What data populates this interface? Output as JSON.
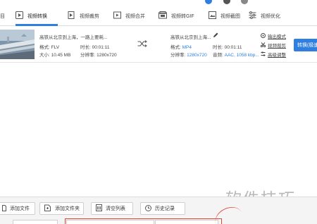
{
  "tabs": [
    {
      "label": "目",
      "icon": "partial-icon"
    },
    {
      "label": "视频转换",
      "icon": "video-convert-icon",
      "active": true
    },
    {
      "label": "视频裁剪",
      "icon": "video-crop-icon"
    },
    {
      "label": "视频合并",
      "icon": "video-merge-icon"
    },
    {
      "label": "视频转GIF",
      "icon": "gif-icon"
    },
    {
      "label": "视频截图",
      "icon": "screenshot-icon"
    },
    {
      "label": "视频优化",
      "icon": "optimize-icon"
    }
  ],
  "file": {
    "source_name": "高铁从北京到上海，一路上要耗...",
    "source_format": "格式: FLV",
    "source_duration": "时长: 00:01:11",
    "source_size": "大小: 10.45 MB",
    "source_resolution": "分辨率: 1280x720",
    "target_name": "高铁从北京到上海...",
    "target_format_label": "格式:",
    "target_format_value": "MP4",
    "target_duration": "时长: 00:01:11",
    "target_resolution_label": "分辨率:",
    "target_resolution_value": "1280x720",
    "target_audio_label": "音频:",
    "target_audio_value": "AAC, 1058 kbp...",
    "actions": [
      "输出模式",
      "视频裁剪",
      "高级调整"
    ],
    "convert_label": "转换(极速"
  },
  "bottom": {
    "buttons": [
      {
        "label": "添加文件",
        "icon": "add-file-icon"
      },
      {
        "label": "添加文件夹",
        "icon": "add-folder-icon"
      },
      {
        "label": "清空列表",
        "icon": "clear-list-icon"
      },
      {
        "label": "历史记录",
        "icon": "history-icon"
      }
    ],
    "watermark": "软件技巧"
  },
  "colors": {
    "accent": "#2f7fe0",
    "highlight": "#e0463a"
  }
}
